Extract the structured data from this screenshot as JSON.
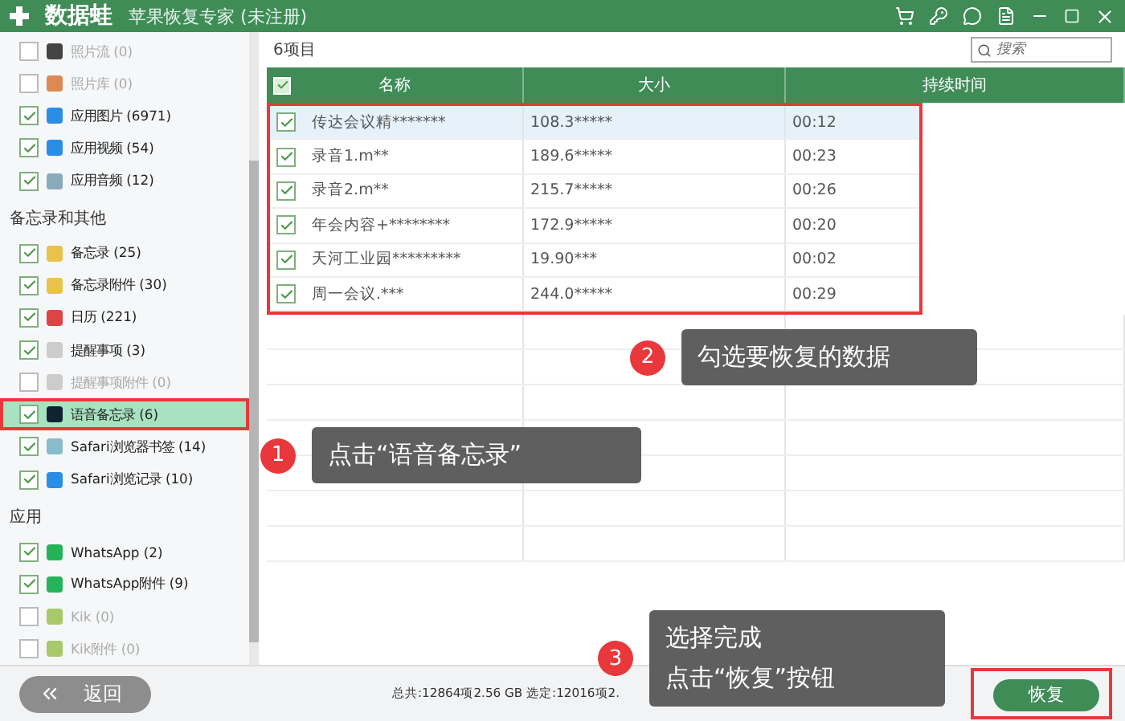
{
  "window": {
    "logo": "数据蛙",
    "title": "苹果恢复专家 (未注册)"
  },
  "sidebar": {
    "groups": [
      {
        "items": [
          {
            "label": "照片流 (0)",
            "checked": false,
            "disabled": true,
            "selected": false
          },
          {
            "label": "照片库 (0)",
            "checked": false,
            "disabled": true,
            "selected": false
          },
          {
            "label": "应用图片 (6971)",
            "checked": true,
            "disabled": false,
            "selected": false
          },
          {
            "label": "应用视频 (54)",
            "checked": true,
            "disabled": false,
            "selected": false
          },
          {
            "label": "应用音频 (12)",
            "checked": true,
            "disabled": false,
            "selected": false
          }
        ]
      },
      {
        "heading": "备忘录和其他",
        "items": [
          {
            "label": "备忘录 (25)",
            "checked": true,
            "disabled": false,
            "selected": false
          },
          {
            "label": "备忘录附件 (30)",
            "checked": true,
            "disabled": false,
            "selected": false
          },
          {
            "label": "日历 (221)",
            "checked": true,
            "disabled": false,
            "selected": false
          },
          {
            "label": "提醒事项 (3)",
            "checked": true,
            "disabled": false,
            "selected": false
          },
          {
            "label": "提醒事项附件 (0)",
            "checked": false,
            "disabled": true,
            "selected": false
          },
          {
            "label": "语音备忘录 (6)",
            "checked": true,
            "disabled": false,
            "selected": true
          },
          {
            "label": "Safari浏览器书签 (14)",
            "checked": true,
            "disabled": false,
            "selected": false
          },
          {
            "label": "Safari浏览记录 (10)",
            "checked": true,
            "disabled": false,
            "selected": false
          }
        ]
      },
      {
        "heading": "应用",
        "items": [
          {
            "label": "WhatsApp (2)",
            "checked": true,
            "disabled": false,
            "selected": false
          },
          {
            "label": "WhatsApp附件 (9)",
            "checked": true,
            "disabled": false,
            "selected": false
          },
          {
            "label": "Kik (0)",
            "checked": false,
            "disabled": true,
            "selected": false
          },
          {
            "label": "Kik附件 (0)",
            "checked": false,
            "disabled": true,
            "selected": false
          }
        ]
      }
    ]
  },
  "main": {
    "item_count": "6项目",
    "search": {
      "placeholder": "搜索"
    },
    "table": {
      "header_checked": true,
      "columns": [
        "名称",
        "大小",
        "持续时间"
      ],
      "rows": [
        {
          "name": "传达会议精*******",
          "size": "108.3*****",
          "duration": "00:12",
          "checked": true,
          "selected": true
        },
        {
          "name": "录音1.m**",
          "size": "189.6*****",
          "duration": "00:23",
          "checked": true,
          "selected": false
        },
        {
          "name": "录音2.m**",
          "size": "215.7*****",
          "duration": "00:26",
          "checked": true,
          "selected": false
        },
        {
          "name": "年会内容+********",
          "size": "172.9*****",
          "duration": "00:20",
          "checked": true,
          "selected": false
        },
        {
          "name": "天河工业园*********",
          "size": "19.90***",
          "duration": "00:02",
          "checked": true,
          "selected": false
        },
        {
          "name": "周一会议.***",
          "size": "244.0*****",
          "duration": "00:29",
          "checked": true,
          "selected": false
        }
      ]
    }
  },
  "status_bar": {
    "summary": "总共:12864项2.56 GB 选定:12016项2.",
    "back_button": "返回",
    "recover_button": "恢复"
  },
  "callouts": [
    {
      "number": "1",
      "lines": [
        "点击“语音备忘录”"
      ]
    },
    {
      "number": "2",
      "lines": [
        "勾选要恢复的数据"
      ]
    },
    {
      "number": "3",
      "lines": [
        "选择完成",
        "点击“恢复”按钮"
      ]
    }
  ]
}
